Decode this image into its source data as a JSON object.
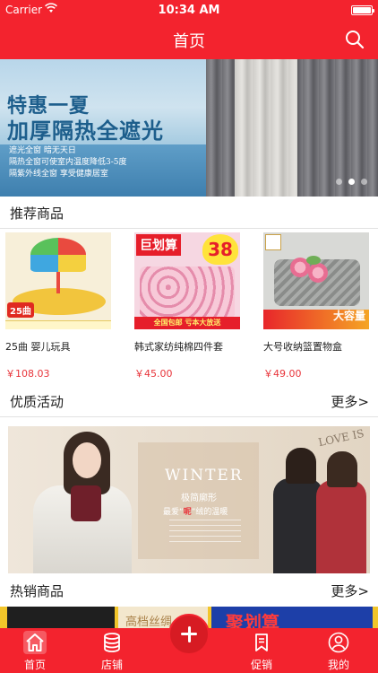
{
  "status_bar": {
    "carrier": "Carrier",
    "time": "10:34 AM"
  },
  "nav": {
    "title": "首页",
    "search_icon": "search-icon"
  },
  "banner": {
    "title_line1": "特惠一夏",
    "title_line2": "加厚隔热全遮光",
    "lines": [
      "遮光全窗 暗无天日",
      "隔热全窗可使室内温度降低3-5度",
      "隔紫外线全窗 享受健康居室"
    ],
    "page_count": 3,
    "active_page": 2
  },
  "recommended": {
    "title": "推荐商品",
    "products": [
      {
        "name": "25曲 婴儿玩具",
        "price": "￥108.03",
        "image_text": "25曲"
      },
      {
        "name": "韩式家纺纯棉四件套",
        "price": "￥45.00",
        "image_text": "巨划算",
        "image_price": "38",
        "image_bottom": "全国包邮 亏本大放送"
      },
      {
        "name": "大号收纳篮置物盒",
        "price": "￥49.00",
        "image_text": "大容量"
      }
    ]
  },
  "activity": {
    "title": "优质活动",
    "more": "更多>",
    "banner_word": "WINTER",
    "banner_sub1": "极简廓形",
    "banner_sub2_prefix": "最爱",
    "banner_sub2_highlight": "呢",
    "banner_sub2_suffix": "绒的温暖",
    "banner_corner": "LOVE IS"
  },
  "hot": {
    "title": "热销商品",
    "more": "更多>",
    "strip_mid": "高档丝绸",
    "strip_right": "聚划算"
  },
  "tab_bar": {
    "tabs": [
      {
        "label": "首页",
        "icon": "home-icon",
        "active": true
      },
      {
        "label": "店铺",
        "icon": "database-icon",
        "active": false
      },
      {
        "label": "促销",
        "icon": "bookmark-icon",
        "active": false
      },
      {
        "label": "我的",
        "icon": "user-icon",
        "active": false
      }
    ],
    "center_icon": "plus-icon"
  },
  "colors": {
    "brand": "#f3232e",
    "price": "#e8343a"
  }
}
